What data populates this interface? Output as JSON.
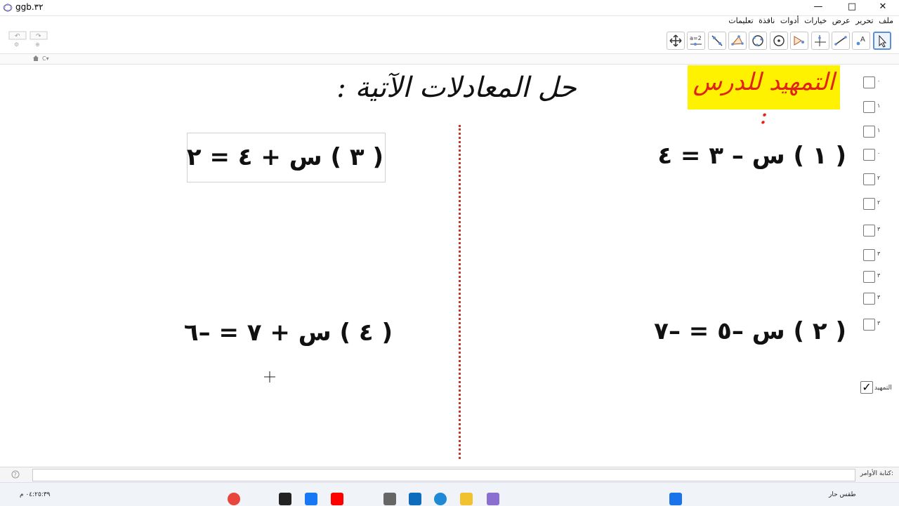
{
  "window": {
    "title": "ggb.٣٢",
    "minimize_glyph": "—",
    "maximize_glyph": "□",
    "close_glyph": "✕"
  },
  "menu": [
    "ملف",
    "تحرير",
    "عرض",
    "خيارات",
    "أدوات",
    "نافذة",
    "تعليمات"
  ],
  "toolbar": {
    "tools": [
      "move-icon",
      "slider-icon",
      "line-icon",
      "polygon-icon",
      "circle-icon",
      "circle-center-icon",
      "reflect-icon",
      "perpendicular-icon",
      "segment-icon",
      "point-icon",
      "select-icon"
    ]
  },
  "canvas": {
    "banner": "التمهيد للدرس :",
    "banner_color": "#fff200",
    "banner_text_color": "#e0241b",
    "heading": "حل المعادلات الآتية :",
    "equations": [
      {
        "label": "( ١ ) س – ٣ = ٤"
      },
      {
        "label": "( ٢ ) س –٥ = –٧"
      },
      {
        "label": "( ٣ ) س + ٤ = ٢"
      },
      {
        "label": "( ٤ ) س + ٧ = –٦"
      }
    ],
    "divider_color": "#c0392b"
  },
  "checkbox_labels": [
    "٠",
    "١",
    "١",
    "٠",
    "٢",
    "٢",
    "٣",
    "٣",
    "٣",
    "٣",
    "٣"
  ],
  "checkbox_check": {
    "label": "التمهيد",
    "checked": true
  },
  "input_bar": {
    "label": "كتابة الأوامر:"
  },
  "taskbar": {
    "weather": "طقس حار",
    "time": "٠٤:٢٥:٣٩ م"
  }
}
